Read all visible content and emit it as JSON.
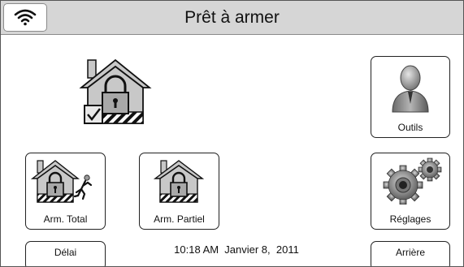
{
  "header": {
    "title": "Prêt à armer",
    "wifi_icon": "wifi-icon"
  },
  "status": {
    "icon": "house-locked-checked-icon"
  },
  "tiles": {
    "outils": "Outils",
    "arm_total": "Arm. Total",
    "arm_partiel": "Arm. Partiel",
    "reglages": "Réglages"
  },
  "footer": {
    "delai_label": "Délai",
    "datetime": "10:18 AM  Janvier 8,  2011",
    "arriere_label": "Arrière"
  },
  "colors": {
    "header_bg": "#d6d6d6",
    "house_fill": "#c8c8c8",
    "border": "#222222"
  }
}
